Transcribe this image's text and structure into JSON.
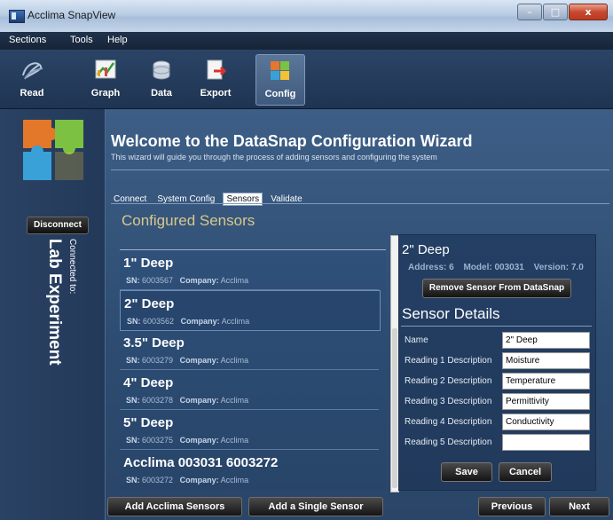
{
  "window": {
    "title": "Acclima SnapView",
    "controls": [
      "–",
      "□",
      "x"
    ]
  },
  "menu": [
    "Sections",
    "Tools",
    "Help"
  ],
  "toolbar": [
    {
      "label": "Read",
      "icon": "read-icon"
    },
    {
      "label": "Graph",
      "icon": "graph-icon"
    },
    {
      "label": "Data",
      "icon": "data-icon"
    },
    {
      "label": "Export",
      "icon": "export-icon"
    },
    {
      "label": "Config",
      "icon": "config-icon",
      "active": true
    }
  ],
  "sidebar": {
    "disconnect_label": "Disconnect",
    "connected_to_label": "Connected to:",
    "connection_name": "Lab Experiment"
  },
  "wizard": {
    "title": "Welcome to the DataSnap Configuration Wizard",
    "subtitle": "This wizard will guide you through the process of adding sensors and configuring the system",
    "tabs": [
      {
        "label": "Connect"
      },
      {
        "label": "System Config"
      },
      {
        "label": "Sensors",
        "active": true
      },
      {
        "label": "Validate"
      }
    ]
  },
  "sensors": {
    "heading": "Configured Sensors",
    "sn_label": "SN:",
    "company_label": "Company:",
    "items": [
      {
        "name": "1\" Deep",
        "sn": "6003567",
        "company": "Acclima"
      },
      {
        "name": "2\" Deep",
        "sn": "6003562",
        "company": "Acclima",
        "selected": true
      },
      {
        "name": "3.5\" Deep",
        "sn": "6003279",
        "company": "Acclima"
      },
      {
        "name": "4\" Deep",
        "sn": "6003278",
        "company": "Acclima"
      },
      {
        "name": "5\" Deep",
        "sn": "6003275",
        "company": "Acclima"
      },
      {
        "name": "Acclima 003031 6003272",
        "sn": "6003272",
        "company": "Acclima"
      }
    ]
  },
  "details": {
    "title": "2\" Deep",
    "address": "Address: 6",
    "model": "Model: 003031",
    "version": "Version: 7.0",
    "remove_label": "Remove Sensor From DataSnap",
    "section_title": "Sensor Details",
    "fields": [
      {
        "label": "Name",
        "value": "2\" Deep"
      },
      {
        "label": "Reading 1 Description",
        "value": "Moisture"
      },
      {
        "label": "Reading 2 Description",
        "value": "Temperature"
      },
      {
        "label": "Reading 3 Description",
        "value": "Permittivity"
      },
      {
        "label": "Reading 4 Description",
        "value": "Conductivity"
      },
      {
        "label": "Reading 5 Description",
        "value": ""
      }
    ],
    "save_label": "Save",
    "cancel_label": "Cancel"
  },
  "footer": {
    "add_acclima_label": "Add Acclima Sensors",
    "add_single_label": "Add a Single Sensor",
    "previous_label": "Previous",
    "next_label": "Next"
  },
  "colors": {
    "toolbar_bg": "#1f3452",
    "content_bg": "#3d5e86",
    "heading_gold": "#d8c98a",
    "selected_row": "#27456d"
  }
}
